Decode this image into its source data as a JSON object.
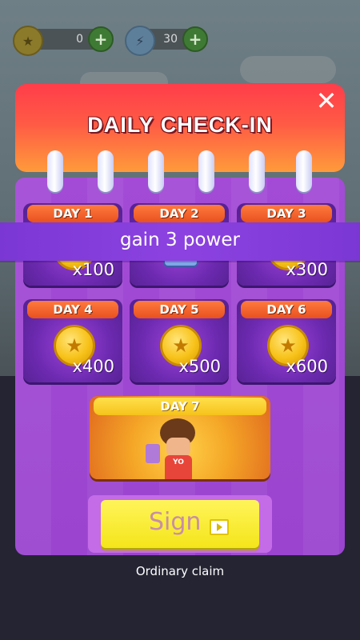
{
  "resources": {
    "coins": {
      "icon": "star-coin-icon",
      "value": "0"
    },
    "power": {
      "icon": "lightning-icon",
      "value": "30"
    }
  },
  "modal": {
    "title": "DAILY CHECK-IN",
    "banner": "gain 3 power",
    "days": [
      {
        "label": "DAY 1",
        "reward": "x100",
        "icon": "coin-icon"
      },
      {
        "label": "DAY 2",
        "reward": "",
        "icon": "robot-character-icon"
      },
      {
        "label": "DAY 3",
        "reward": "x300",
        "icon": "coin-icon"
      },
      {
        "label": "DAY 4",
        "reward": "x400",
        "icon": "coin-icon"
      },
      {
        "label": "DAY 5",
        "reward": "x500",
        "icon": "coin-icon"
      },
      {
        "label": "DAY 6",
        "reward": "x600",
        "icon": "coin-icon"
      }
    ],
    "day7": {
      "label": "DAY 7",
      "shirt_text": "YO",
      "icon": "character-reward-icon"
    },
    "sign_label": "Sign",
    "ordinary_claim": "Ordinary claim"
  },
  "colors": {
    "header_top": "#ff3d4a",
    "header_bottom": "#ff9b3a",
    "body": "#a34bd6",
    "sign_button": "#fff45a",
    "day_label": "#e8501f"
  }
}
